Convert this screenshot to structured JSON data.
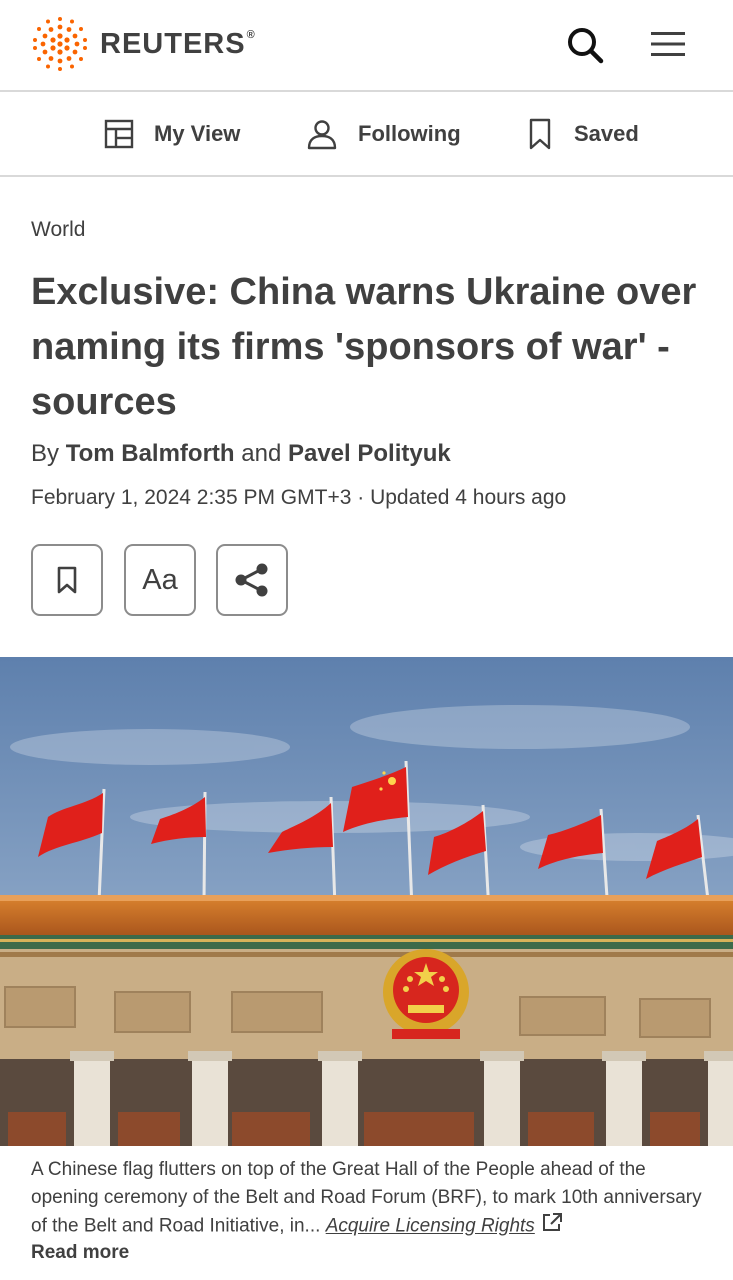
{
  "brand": {
    "name": "REUTERS",
    "registered_mark": "®",
    "logo_color": "#fa6400"
  },
  "header": {
    "search_icon": "search-icon",
    "menu_icon": "hamburger-menu-icon"
  },
  "subnav": {
    "items": [
      {
        "label": "My View",
        "icon": "layout-icon"
      },
      {
        "label": "Following",
        "icon": "person-icon"
      },
      {
        "label": "Saved",
        "icon": "bookmark-icon"
      }
    ]
  },
  "article": {
    "section": "World",
    "headline": "Exclusive: China warns Ukraine over naming its firms 'sponsors of war' - sources",
    "byline": {
      "prefix": "By",
      "author1": "Tom Balmforth",
      "conjunction": "and",
      "author2": "Pavel Polityuk"
    },
    "dateline": "February 1, 2024 2:35 PM GMT+3 · Updated 4 hours ago",
    "actions": {
      "bookmark_icon": "bookmark-icon",
      "font_size_label": "Aa",
      "share_icon": "share-icon"
    }
  },
  "image": {
    "caption": "A Chinese flag flutters on top of the Great Hall of the People ahead of the opening ceremony of the Belt and Road Forum (BRF), to mark 10th anniversary of the Belt and Road Initiative, in...",
    "licensing_link": "Acquire Licensing Rights",
    "external_icon": "external-link-icon",
    "read_more": "Read more"
  },
  "colors": {
    "text": "#404040",
    "divider": "#d9d9d9",
    "flag_red": "#e0201b"
  }
}
